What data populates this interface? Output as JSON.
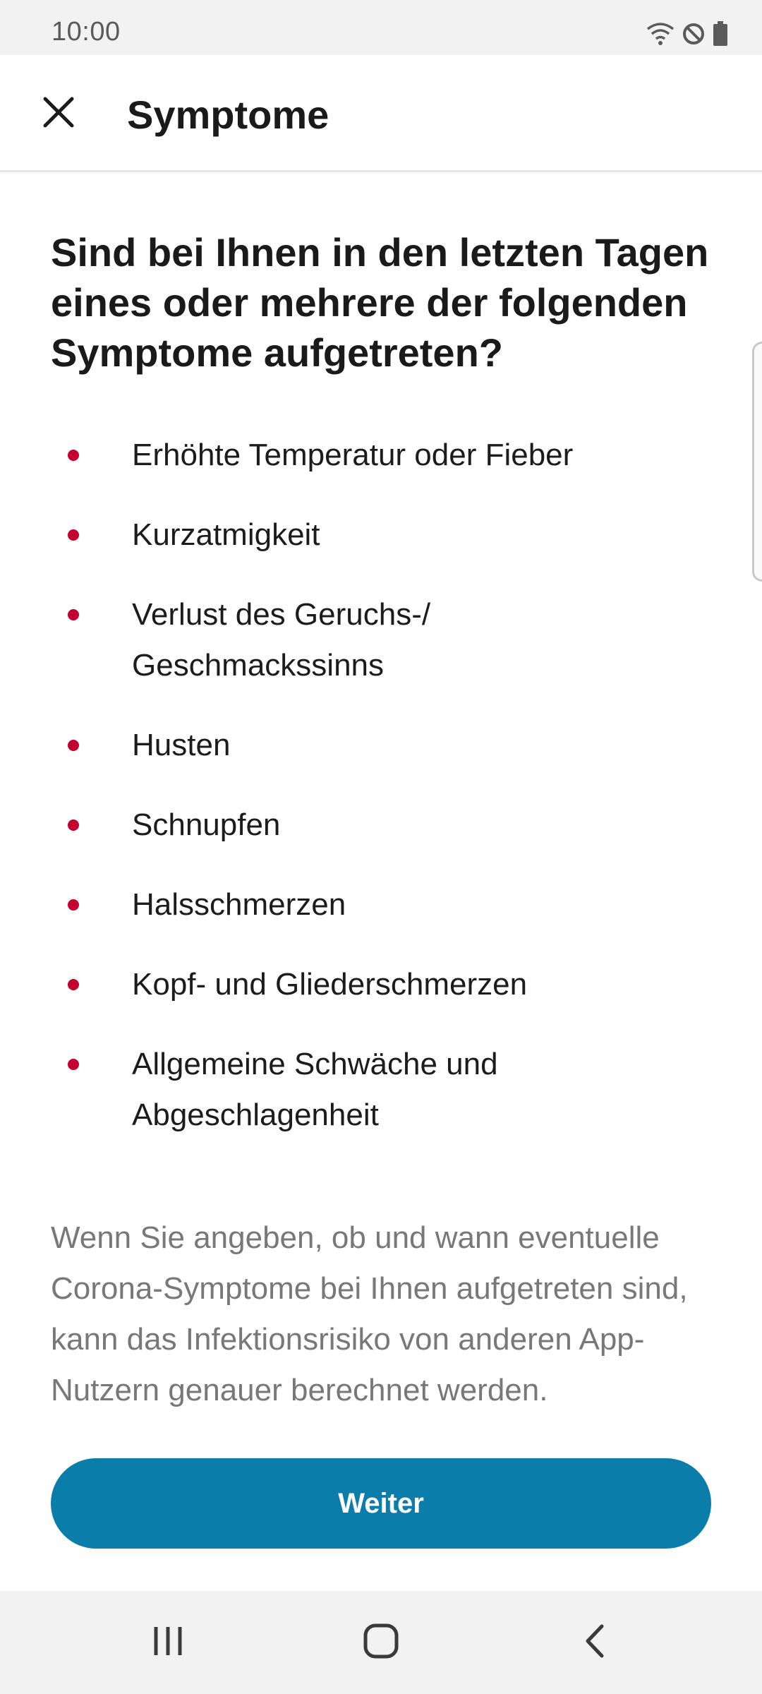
{
  "status_bar": {
    "time": "10:00",
    "icons": [
      "wifi-icon",
      "do-not-disturb-icon",
      "battery-icon"
    ]
  },
  "app_bar": {
    "close_icon": "close-icon",
    "title": "Symptome"
  },
  "question": "Sind bei Ihnen in den letzten Tagen eines oder mehrere der folgenden Symptome aufgetreten?",
  "symptoms": [
    "Erhöhte Temperatur oder Fieber",
    "Kurzatmigkeit",
    "Verlust des Geruchs-/ Geschmackssinns",
    "Husten",
    "Schnupfen",
    "Halsschmerzen",
    "Kopf- und Gliederschmerzen",
    "Allgemeine Schwäche und Abgeschlagenheit"
  ],
  "info_text": "Wenn Sie angeben, ob und wann eventuelle Corona-Symptome bei Ihnen aufgetreten sind, kann das Infektionsrisiko von anderen App-Nutzern genauer berechnet werden.",
  "button": {
    "label": "Weiter"
  },
  "nav_bar": {
    "icons": [
      "recent-apps-icon",
      "home-icon",
      "back-icon"
    ]
  },
  "colors": {
    "accent": "#0a7dab",
    "bullet": "#c3002f",
    "muted_text": "#787878"
  }
}
